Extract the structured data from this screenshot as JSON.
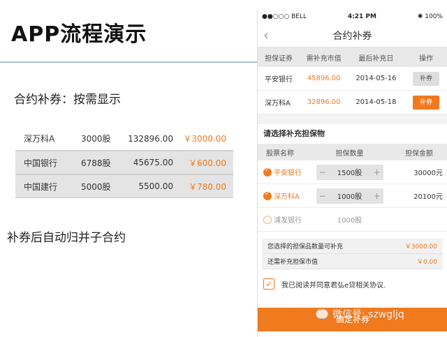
{
  "slide": {
    "title": "APP流程演示",
    "subtitle": "合约补券：按需显示",
    "note": "补券后自动归并子合约",
    "table": [
      {
        "name": "深万科A",
        "shares": "3000股",
        "value": "132896.00",
        "amount": "￥3000.00"
      },
      {
        "name": "中国银行",
        "shares": "6788股",
        "value": "45675.00",
        "amount": "￥600.00"
      },
      {
        "name": "中国建行",
        "shares": "5000股",
        "value": "5500.00",
        "amount": "￥780.00"
      }
    ]
  },
  "phone": {
    "status": {
      "carrier": "●●○○○ BELL",
      "time": "4:21 PM",
      "battery": "✱ 100%"
    },
    "nav": {
      "back": "‹",
      "title": "合约补券"
    },
    "list_headers": [
      "担保证券",
      "需补充市值",
      "最后补充日",
      "操作"
    ],
    "list_rows": [
      {
        "name": "平安银行",
        "value": "45896.00",
        "date": "2014-05-16",
        "action": "补券"
      },
      {
        "name": "深万科A",
        "value": "32896.00",
        "date": "2014-05-18",
        "action": "补券"
      }
    ],
    "collateral_title": "请选择补充担保物",
    "collateral_headers": [
      "股票名称",
      "担保数量",
      "担保金额"
    ],
    "collateral_rows": [
      {
        "name": "平安银行",
        "qty": "1500股",
        "amount": "30000元"
      },
      {
        "name": "深万科A",
        "qty": "1000股",
        "amount": "20100元"
      },
      {
        "name": "浦发银行",
        "qty": "1000股",
        "amount": ""
      }
    ],
    "summary": [
      {
        "label": "您选择的担保品数量可补充",
        "value": "￥3000.00"
      },
      {
        "label": "还需补充担保市值",
        "value": "￥0.00"
      }
    ],
    "agree_text": "我已阅读并同意君弘e贷相关协议.",
    "check_mark": "✓",
    "submit_label": "确定补券",
    "stepper_minus": "−",
    "stepper_plus": "+"
  },
  "watermark": "微信号: szwgljq",
  "colors": {
    "accent": "#f07a1e",
    "rule": "#9ec6d8"
  }
}
